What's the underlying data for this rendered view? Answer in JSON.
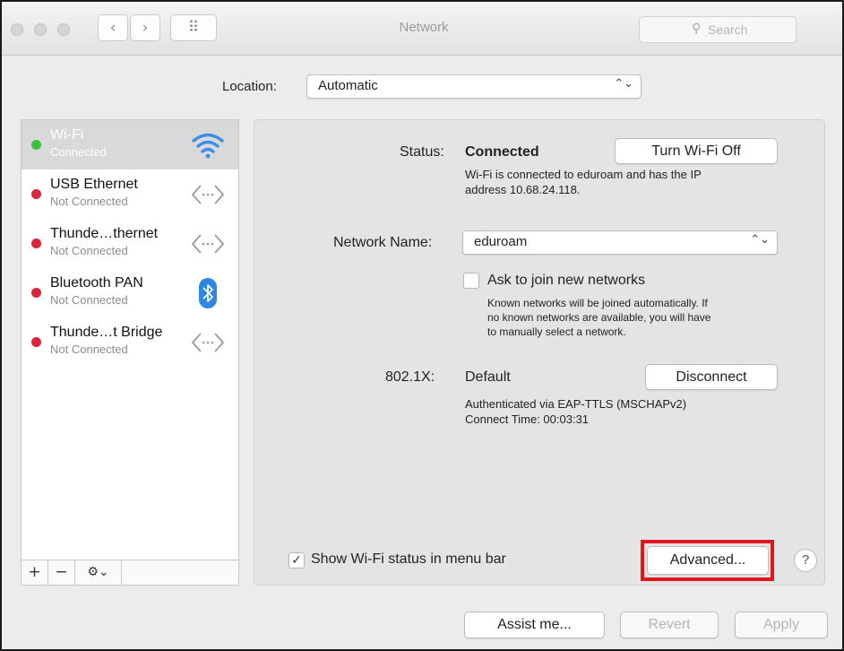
{
  "window": {
    "title": "Network"
  },
  "toolbar": {
    "back_glyph": "‹",
    "forward_glyph": "›",
    "grid_glyph": "⠿",
    "search_placeholder": "Search"
  },
  "location": {
    "label": "Location:",
    "value": "Automatic"
  },
  "services": [
    {
      "name": "Wi-Fi",
      "status": "Connected",
      "status_color": "#3cc13c",
      "icon": "wifi-icon"
    },
    {
      "name": "USB Ethernet",
      "status": "Not Connected",
      "status_color": "#d9263c",
      "icon": "ethernet-arrows-icon"
    },
    {
      "name": "Thunde…thernet",
      "status": "Not Connected",
      "status_color": "#d9263c",
      "icon": "ethernet-arrows-icon"
    },
    {
      "name": "Bluetooth PAN",
      "status": "Not Connected",
      "status_color": "#d9263c",
      "icon": "bluetooth-icon"
    },
    {
      "name": "Thunde…t Bridge",
      "status": "Not Connected",
      "status_color": "#d9263c",
      "icon": "ethernet-arrows-icon"
    }
  ],
  "sidebar_toolbar": {
    "add": "+",
    "remove": "−",
    "action": "⚙⌄"
  },
  "status": {
    "label": "Status:",
    "value": "Connected",
    "button": "Turn Wi-Fi Off",
    "description_line1": "Wi-Fi is connected to eduroam and has the IP",
    "description_line2": "address 10.68.24.118."
  },
  "network_name": {
    "label": "Network Name:",
    "value": "eduroam"
  },
  "ask_join": {
    "label": "Ask to join new networks",
    "checked": false,
    "note_line1": "Known networks will be joined automatically. If",
    "note_line2": "no known networks are available, you will have",
    "note_line3": "to manually select a network."
  },
  "auth": {
    "label": "802.1X:",
    "value": "Default",
    "button": "Disconnect",
    "detail_line1": "Authenticated via EAP-TTLS (MSCHAPv2)",
    "detail_line2": "Connect Time: 00:03:31"
  },
  "show_status": {
    "label": "Show Wi-Fi status in menu bar",
    "checked": true,
    "check_glyph": "✓"
  },
  "buttons": {
    "advanced": "Advanced...",
    "help": "?",
    "assist": "Assist me...",
    "revert": "Revert",
    "apply": "Apply"
  },
  "colors": {
    "highlight": "#e0161f",
    "selected_row": "#d9d9d9",
    "bluetooth": "#2f86e5",
    "wifi": "#3a8ee6"
  }
}
